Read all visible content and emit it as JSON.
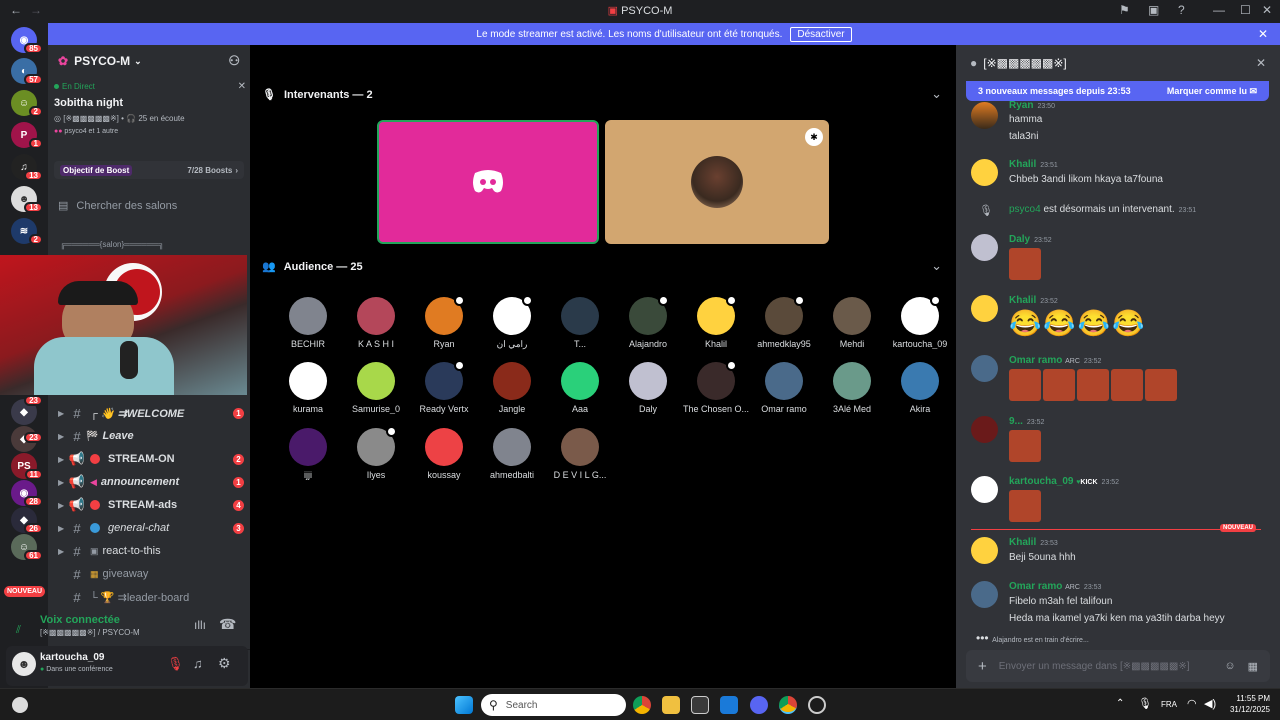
{
  "window": {
    "title": "PSYCO-M"
  },
  "banner": {
    "text": "Le mode streamer est activé. Les noms d'utilisateur ont été tronqués.",
    "button": "Désactiver"
  },
  "servers": [
    {
      "badge": "85",
      "color": "#5865f2"
    },
    {
      "badge": "57",
      "color": "#3a6ea5"
    },
    {
      "badge": "2",
      "color": "#6b8e23"
    },
    {
      "badge": "1",
      "color": "#a0144a"
    },
    {
      "badge": "13",
      "color": "#222222"
    },
    {
      "badge": "13",
      "color": "#ffffff"
    },
    {
      "badge": "2",
      "color": "#1e90ff"
    }
  ],
  "server_bottom_badges": [
    "23",
    "23",
    "11",
    "28",
    "26",
    "61"
  ],
  "server_new_label": "NOUVEAU",
  "channel_panel": {
    "server_name": "PSYCO-M",
    "live_label": "En Direct",
    "event_title": "3obitha night",
    "event_channel": "[※▩▩▩▩▩※]",
    "event_listeners": "25 en écoute",
    "event_people": "psyco4 et 1 autre",
    "boost_label": "Objectif de Boost",
    "boost_count": "7/28 Boosts",
    "search_channels": "Chercher des salons",
    "salon_separator": "╔══════{salon}══════╗",
    "channels": [
      {
        "name": "┌ 👋 ⇉WELCOME",
        "count": "1",
        "kind": "text"
      },
      {
        "name": "Leave",
        "count": "",
        "kind": "text"
      },
      {
        "name": "STREAM-ON",
        "count": "2",
        "kind": "announce"
      },
      {
        "name": "announcement",
        "count": "1",
        "kind": "announce"
      },
      {
        "name": "STREAM-ads",
        "count": "4",
        "kind": "announce"
      },
      {
        "name": "general-chat",
        "count": "3",
        "kind": "text"
      },
      {
        "name": "react-to-this",
        "count": "",
        "kind": "text"
      },
      {
        "name": "giveaway",
        "count": "",
        "kind": "text"
      },
      {
        "name": "└ 🏆 ⇉leader-board",
        "count": "",
        "kind": "text"
      }
    ],
    "voice_connected": "Voix connectée",
    "voice_channel": "[※▩▩▩▩▩※] / PSYCO-M",
    "username": "kartoucha_09",
    "user_status": "Dans une conférence"
  },
  "stage": {
    "speakers_label": "Intervenants — 2",
    "audience_label": "Audience — 25",
    "audience": [
      {
        "name": "BECHIR",
        "color": "#80848e",
        "mod": false
      },
      {
        "name": "K A S H I",
        "color": "#b4475a",
        "mod": false
      },
      {
        "name": "Ryan",
        "color": "#e07b22",
        "mod": true
      },
      {
        "name": "رامي ان",
        "color": "#ffffff",
        "mod": true
      },
      {
        "name": "T...",
        "color": "#2a3a4a",
        "mod": false
      },
      {
        "name": "Alajandro",
        "color": "#3a4a3a",
        "mod": true
      },
      {
        "name": "Khalil",
        "color": "#ffd23f",
        "mod": true
      },
      {
        "name": "ahmedklay95",
        "color": "#5a4a3a",
        "mod": true
      },
      {
        "name": "Mehdi",
        "color": "#6a5a4a",
        "mod": false
      },
      {
        "name": "kartoucha_09",
        "color": "#ffffff",
        "mod": true
      },
      {
        "name": "kurama",
        "color": "#ffffff",
        "mod": false
      },
      {
        "name": "Samurise_0",
        "color": "#a8d84a",
        "mod": false
      },
      {
        "name": "Ready Vertx",
        "color": "#2a3a5a",
        "mod": true
      },
      {
        "name": "Jangle",
        "color": "#8a2a1a",
        "mod": false
      },
      {
        "name": "Aaa",
        "color": "#2ad07a",
        "mod": false
      },
      {
        "name": "Daly",
        "color": "#c0c0d0",
        "mod": false
      },
      {
        "name": "The Chosen O...",
        "color": "#3a2a2a",
        "mod": true
      },
      {
        "name": "Omar ramo",
        "color": "#4a6a8a",
        "mod": false
      },
      {
        "name": "3Alé Med",
        "color": "#6a9a8a",
        "mod": false
      },
      {
        "name": "Akira",
        "color": "#3a7ab0",
        "mod": false
      },
      {
        "name": "ijji",
        "color": "#4a1a6a",
        "mod": false
      },
      {
        "name": "Ilyes",
        "color": "#8a8a8a",
        "mod": true
      },
      {
        "name": "koussay",
        "color": "#ed4245",
        "mod": false
      },
      {
        "name": "ahmedbalti",
        "color": "#80848e",
        "mod": false
      },
      {
        "name": "D E V I L G...",
        "color": "#7a5a4a",
        "mod": false
      }
    ]
  },
  "chat": {
    "channel": "[※▩▩▩▩▩※]",
    "new_messages": "3 nouveaux messages depuis 23:53",
    "mark_read": "Marquer comme lu",
    "new_divider": "NOUVEAU",
    "typing": "Alajandro est en train d'écrire...",
    "input_placeholder": "Envoyer un message dans [※▩▩▩▩▩※]",
    "messages": [
      {
        "user": "Ryan",
        "time": "23:50",
        "lines": [
          "hamma",
          "tala3ni"
        ],
        "color": "#43b581"
      },
      {
        "user": "Khalil",
        "time": "23:51",
        "lines": [
          "Chbeb 3andi likom hkaya ta7founa"
        ],
        "color": "#43b581"
      },
      {
        "user": "psyco4",
        "time": "23:51",
        "lines": [
          "est désormais un intervenant."
        ],
        "color": "#43b581"
      },
      {
        "user": "Daly",
        "time": "23:52",
        "lines": [],
        "color": "#43b581"
      },
      {
        "user": "Khalil",
        "time": "23:52",
        "lines": [],
        "color": "#43b581"
      },
      {
        "user": "Omar ramo",
        "time": "23:52",
        "lines": [],
        "color": "#43b581"
      },
      {
        "user": "9...",
        "time": "23:52",
        "lines": [],
        "color": "#43b581"
      },
      {
        "user": "kartoucha_09",
        "time": "23:52",
        "tag": "KICK",
        "lines": [],
        "color": "#43b581"
      },
      {
        "user": "Khalil",
        "time": "23:53",
        "lines": [
          "Beji 5ouna hhh"
        ],
        "color": "#43b581"
      },
      {
        "user": "Omar ramo",
        "time": "23:53",
        "tag": "ARC",
        "lines": [
          "Fibelo m3ah fel talifoun",
          "Heda ma ikamel ya7ki ken ma ya3tih darba heyy"
        ],
        "color": "#43b581"
      }
    ],
    "omar_tag_1": "ARC"
  },
  "taskbar": {
    "search": "Search",
    "lang": "FRA",
    "time": "11:55 PM",
    "date": "31/12/2025"
  }
}
